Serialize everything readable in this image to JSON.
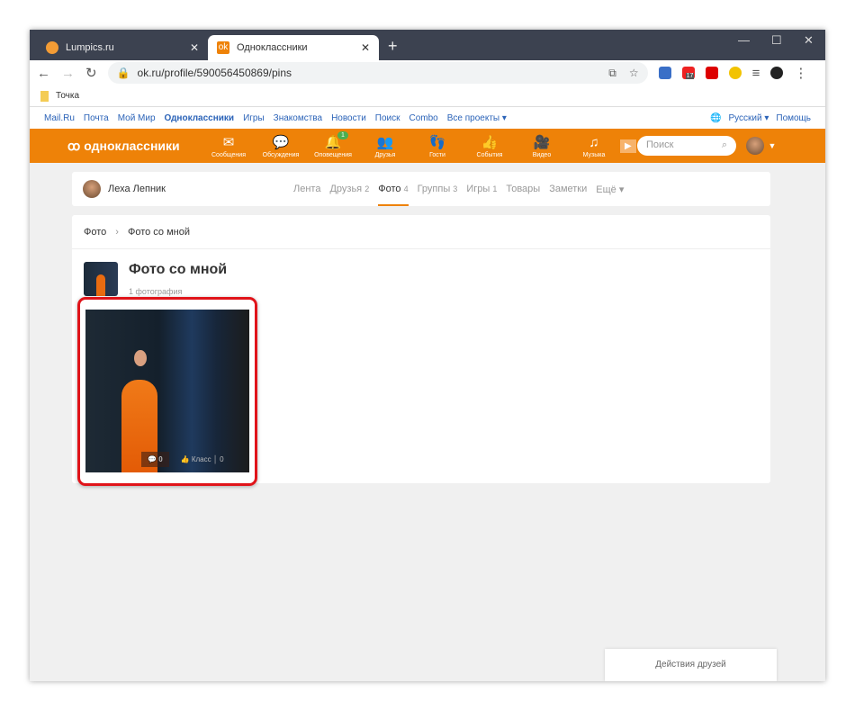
{
  "browser": {
    "tabs": [
      {
        "label": "Lumpics.ru"
      },
      {
        "label": "Одноклассники"
      }
    ],
    "url": "ok.ru/profile/590056450869/pins",
    "bookmark": "Точка",
    "ext_badge": "17"
  },
  "portal": {
    "links": [
      "Mail.Ru",
      "Почта",
      "Мой Мир",
      "Одноклассники",
      "Игры",
      "Знакомства",
      "Новости",
      "Поиск",
      "Combo",
      "Все проекты ▾"
    ],
    "language": "Русский ▾",
    "help": "Помощь"
  },
  "ok": {
    "logo": "одноклассники",
    "nav": [
      {
        "icon": "✉",
        "label": "Сообщения"
      },
      {
        "icon": "💬",
        "label": "Обсуждения"
      },
      {
        "icon": "🔔",
        "label": "Оповещения",
        "badge": "1"
      },
      {
        "icon": "👥",
        "label": "Друзья"
      },
      {
        "icon": "👣",
        "label": "Гости"
      },
      {
        "icon": "👍",
        "label": "События"
      },
      {
        "icon": "🎥",
        "label": "Видео"
      },
      {
        "icon": "♫",
        "label": "Музыка"
      }
    ],
    "search_placeholder": "Поиск"
  },
  "profile": {
    "name": "Леха Лепник",
    "tabs": [
      {
        "label": "Лента",
        "count": ""
      },
      {
        "label": "Друзья",
        "count": "2"
      },
      {
        "label": "Фото",
        "count": "4"
      },
      {
        "label": "Группы",
        "count": "3"
      },
      {
        "label": "Игры",
        "count": "1"
      },
      {
        "label": "Товары",
        "count": ""
      },
      {
        "label": "Заметки",
        "count": ""
      },
      {
        "label": "Ещё ▾",
        "count": ""
      }
    ]
  },
  "album": {
    "breadcrumb": [
      "Фото",
      "Фото со мной"
    ],
    "title": "Фото со мной",
    "count": "1 фотография",
    "photo": {
      "comments": "0",
      "like_label": "Класс",
      "likes": "0"
    }
  },
  "friends_actions": "Действия друзей"
}
